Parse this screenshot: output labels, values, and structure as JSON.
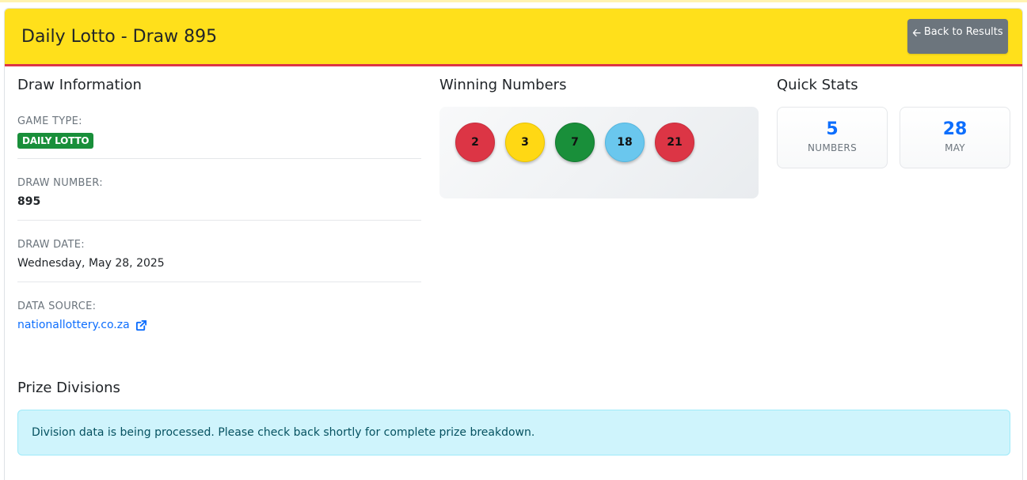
{
  "header": {
    "title": "Daily Lotto - Draw 895",
    "back_label": "Back to Results"
  },
  "draw_info": {
    "title": "Draw Information",
    "game_type_label": "GAME TYPE:",
    "game_type_badge": "DAILY LOTTO",
    "draw_number_label": "DRAW NUMBER:",
    "draw_number": "895",
    "draw_date_label": "DRAW DATE:",
    "draw_date": "Wednesday, May 28, 2025",
    "data_source_label": "DATA SOURCE:",
    "data_source": "nationallottery.co.za"
  },
  "winning_numbers": {
    "title": "Winning Numbers",
    "balls": [
      {
        "value": "2",
        "color": "#dc3545"
      },
      {
        "value": "3",
        "color": "#ffd814"
      },
      {
        "value": "7",
        "color": "#198f3a"
      },
      {
        "value": "18",
        "color": "#6ac7ee"
      },
      {
        "value": "21",
        "color": "#dc3545"
      }
    ]
  },
  "quick_stats": {
    "title": "Quick Stats",
    "stats": [
      {
        "value": "5",
        "label": "NUMBERS"
      },
      {
        "value": "28",
        "label": "MAY"
      }
    ]
  },
  "prize_divisions": {
    "title": "Prize Divisions",
    "message": "Division data is being processed. Please check back shortly for complete prize breakdown."
  },
  "colors": {
    "header_bg": "#ffe01b",
    "header_border": "#dc3545",
    "link": "#0d6efd",
    "badge": "#198f3a"
  }
}
